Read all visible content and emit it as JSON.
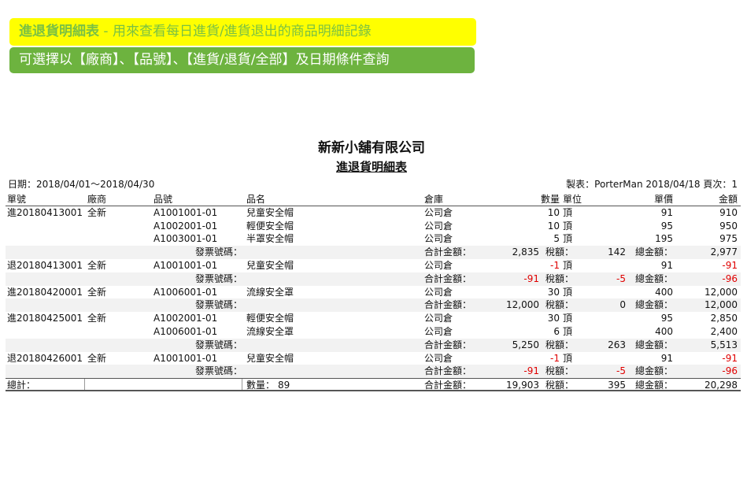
{
  "banner": {
    "title": "進退貨明細表",
    "subtitle": " - 用來查看每日進貨/進貨退出的商品明細記錄",
    "note": "可選擇以【廠商】、【品號】、【進貨/退貨/全部】及日期條件查詢"
  },
  "report": {
    "company": "新新小舖有限公司",
    "title": "進退貨明細表",
    "date_range": "日期：2018/04/01～2018/04/30",
    "maker_info": "製表：PorterMan 2018/04/18 頁次：1"
  },
  "table": {
    "headers": {
      "doc_no": "單號",
      "vendor": "廠商",
      "item_no": "品號",
      "item_name": "品名",
      "warehouse": "倉庫",
      "qty": "數量",
      "unit": "單位",
      "unit_price": "單價",
      "amount": "金額"
    },
    "labels": {
      "invoice": "發票號碼：",
      "subtotal": "合計金額：",
      "tax": "稅額：",
      "grand": "總金額："
    },
    "groups": [
      {
        "doc_no": "進20180413001",
        "vendor": "全新",
        "lines": [
          {
            "item_no": "A1001001-01",
            "item_name": "兒童安全帽",
            "warehouse": "公司倉",
            "qty": "10",
            "unit": "頂",
            "unit_price": "91",
            "amount": "910"
          },
          {
            "item_no": "A1002001-01",
            "item_name": "輕便安全帽",
            "warehouse": "公司倉",
            "qty": "10",
            "unit": "頂",
            "unit_price": "95",
            "amount": "950"
          },
          {
            "item_no": "A1003001-01",
            "item_name": "半罩安全帽",
            "warehouse": "公司倉",
            "qty": "5",
            "unit": "頂",
            "unit_price": "195",
            "amount": "975"
          }
        ],
        "subtotal": "2,835",
        "tax": "142",
        "grand": "2,977",
        "negative": false
      },
      {
        "doc_no": "退20180413001",
        "vendor": "全新",
        "lines": [
          {
            "item_no": "A1001001-01",
            "item_name": "兒童安全帽",
            "warehouse": "公司倉",
            "qty": "-1",
            "unit": "頂",
            "unit_price": "91",
            "amount": "-91"
          }
        ],
        "subtotal": "-91",
        "tax": "-5",
        "grand": "-96",
        "negative": true
      },
      {
        "doc_no": "進20180420001",
        "vendor": "全新",
        "lines": [
          {
            "item_no": "A1006001-01",
            "item_name": "流線安全罩",
            "warehouse": "公司倉",
            "qty": "30",
            "unit": "頂",
            "unit_price": "400",
            "amount": "12,000"
          }
        ],
        "subtotal": "12,000",
        "tax": "0",
        "grand": "12,000",
        "negative": false
      },
      {
        "doc_no": "進20180425001",
        "vendor": "全新",
        "lines": [
          {
            "item_no": "A1002001-01",
            "item_name": "輕便安全帽",
            "warehouse": "公司倉",
            "qty": "30",
            "unit": "頂",
            "unit_price": "95",
            "amount": "2,850"
          },
          {
            "item_no": "A1006001-01",
            "item_name": "流線安全罩",
            "warehouse": "公司倉",
            "qty": "6",
            "unit": "頂",
            "unit_price": "400",
            "amount": "2,400"
          }
        ],
        "subtotal": "5,250",
        "tax": "263",
        "grand": "5,513",
        "negative": false
      },
      {
        "doc_no": "退20180426001",
        "vendor": "全新",
        "lines": [
          {
            "item_no": "A1001001-01",
            "item_name": "兒童安全帽",
            "warehouse": "公司倉",
            "qty": "-1",
            "unit": "頂",
            "unit_price": "91",
            "amount": "-91"
          }
        ],
        "subtotal": "-91",
        "tax": "-5",
        "grand": "-96",
        "negative": true
      }
    ],
    "total": {
      "label": "總計：",
      "qty_label": "數量：",
      "qty": "89",
      "subtotal": "19,903",
      "tax": "395",
      "grand": "20,298"
    }
  },
  "colors": {
    "banner_yellow": "#ffff00",
    "banner_green": "#6db33f",
    "banner_text_green": "#7ac143",
    "negative": "#e00000"
  }
}
